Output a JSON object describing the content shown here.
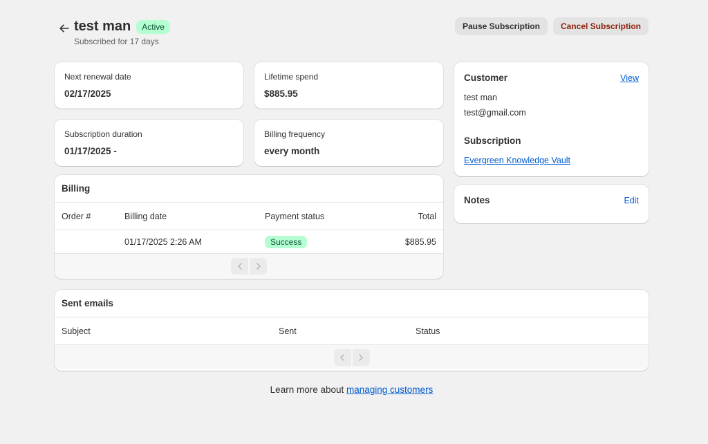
{
  "header": {
    "title": "test man",
    "status_badge": "Active",
    "subtitle": "Subscribed for 17 days",
    "pause_label": "Pause Subscription",
    "cancel_label": "Cancel Subscription"
  },
  "stats": {
    "next_renewal_label": "Next renewal date",
    "next_renewal_value": "02/17/2025",
    "lifetime_spend_label": "Lifetime spend",
    "lifetime_spend_value": "$885.95",
    "duration_label": "Subscription duration",
    "duration_value": "01/17/2025 -",
    "frequency_label": "Billing frequency",
    "frequency_value": "every month"
  },
  "billing": {
    "title": "Billing",
    "columns": [
      "Order #",
      "Billing date",
      "Payment status",
      "Total"
    ],
    "rows": [
      {
        "order": "",
        "date": "01/17/2025 2:26 AM",
        "status": "Success",
        "total": "$885.95"
      }
    ]
  },
  "customer": {
    "title": "Customer",
    "view_label": "View",
    "name": "test man",
    "email": "test@gmail.com",
    "subscription_title": "Subscription",
    "subscription_link": "Evergreen Knowledge Vault"
  },
  "notes": {
    "title": "Notes",
    "edit_label": "Edit"
  },
  "sent_emails": {
    "title": "Sent emails",
    "columns": [
      "Subject",
      "Sent",
      "Status"
    ]
  },
  "footer": {
    "text": "Learn more about ",
    "link": "managing customers"
  },
  "colors": {
    "background": "#f1f1f1",
    "badge_green": "#b4fed2",
    "link_blue": "#005bd3",
    "danger_text": "#8e1f0b"
  }
}
